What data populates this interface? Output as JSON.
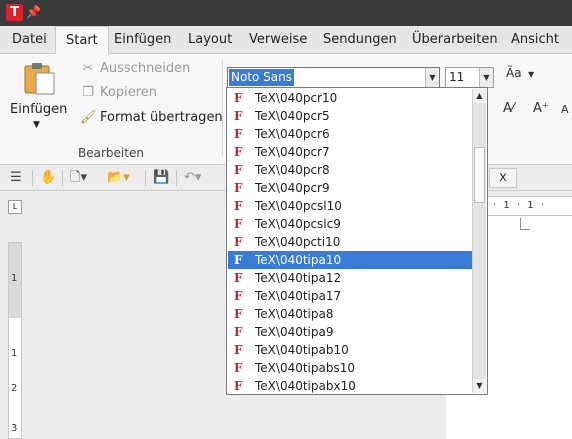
{
  "titlebar": {
    "app_icon": "T",
    "pin_icon": "pin-icon"
  },
  "menubar": {
    "tabs": [
      "Datei",
      "Start",
      "Einfügen",
      "Layout",
      "Verweise",
      "Sendungen",
      "Überarbeiten",
      "Ansicht"
    ],
    "active_tab": "Start"
  },
  "ribbon": {
    "paste_label": "Einfügen",
    "cut_label": "Ausschneiden",
    "copy_label": "Kopieren",
    "format_painter_label": "Format übertragen",
    "group_label": "Bearbeiten",
    "font_name": "Noto Sans",
    "font_size": "11",
    "icons": {
      "case": "change-case-icon",
      "clear": "clear-formatting-icon",
      "grow": "grow-font-icon",
      "shrink": "shrink-font-icon"
    }
  },
  "font_list": {
    "items": [
      "TeX\\040pcr10",
      "TeX\\040pcr5",
      "TeX\\040pcr6",
      "TeX\\040pcr7",
      "TeX\\040pcr8",
      "TeX\\040pcr9",
      "TeX\\040pcsl10",
      "TeX\\040pcslc9",
      "TeX\\040pcti10",
      "TeX\\040tipa10",
      "TeX\\040tipa12",
      "TeX\\040tipa17",
      "TeX\\040tipa8",
      "TeX\\040tipa9",
      "TeX\\040tipab10",
      "TeX\\040tipabs10",
      "TeX\\040tipabx10"
    ],
    "selected": "TeX\\040tipa10",
    "item_icon": "truetype-font-icon"
  },
  "toolbar": {
    "icons": [
      "menu-icon",
      "hand-icon",
      "new-document-icon",
      "open-folder-icon",
      "save-icon",
      "undo-icon"
    ]
  },
  "document_tab": {
    "close_label": "x"
  },
  "ruler": {
    "text": "· 1 · 1 ·",
    "vertical_labels": [
      "1",
      "1",
      "2",
      "3"
    ],
    "corner": "L"
  },
  "colors": {
    "accent": "#3a7bd5",
    "app_red": "#d6232e",
    "titlebar": "#3b3b3b"
  }
}
